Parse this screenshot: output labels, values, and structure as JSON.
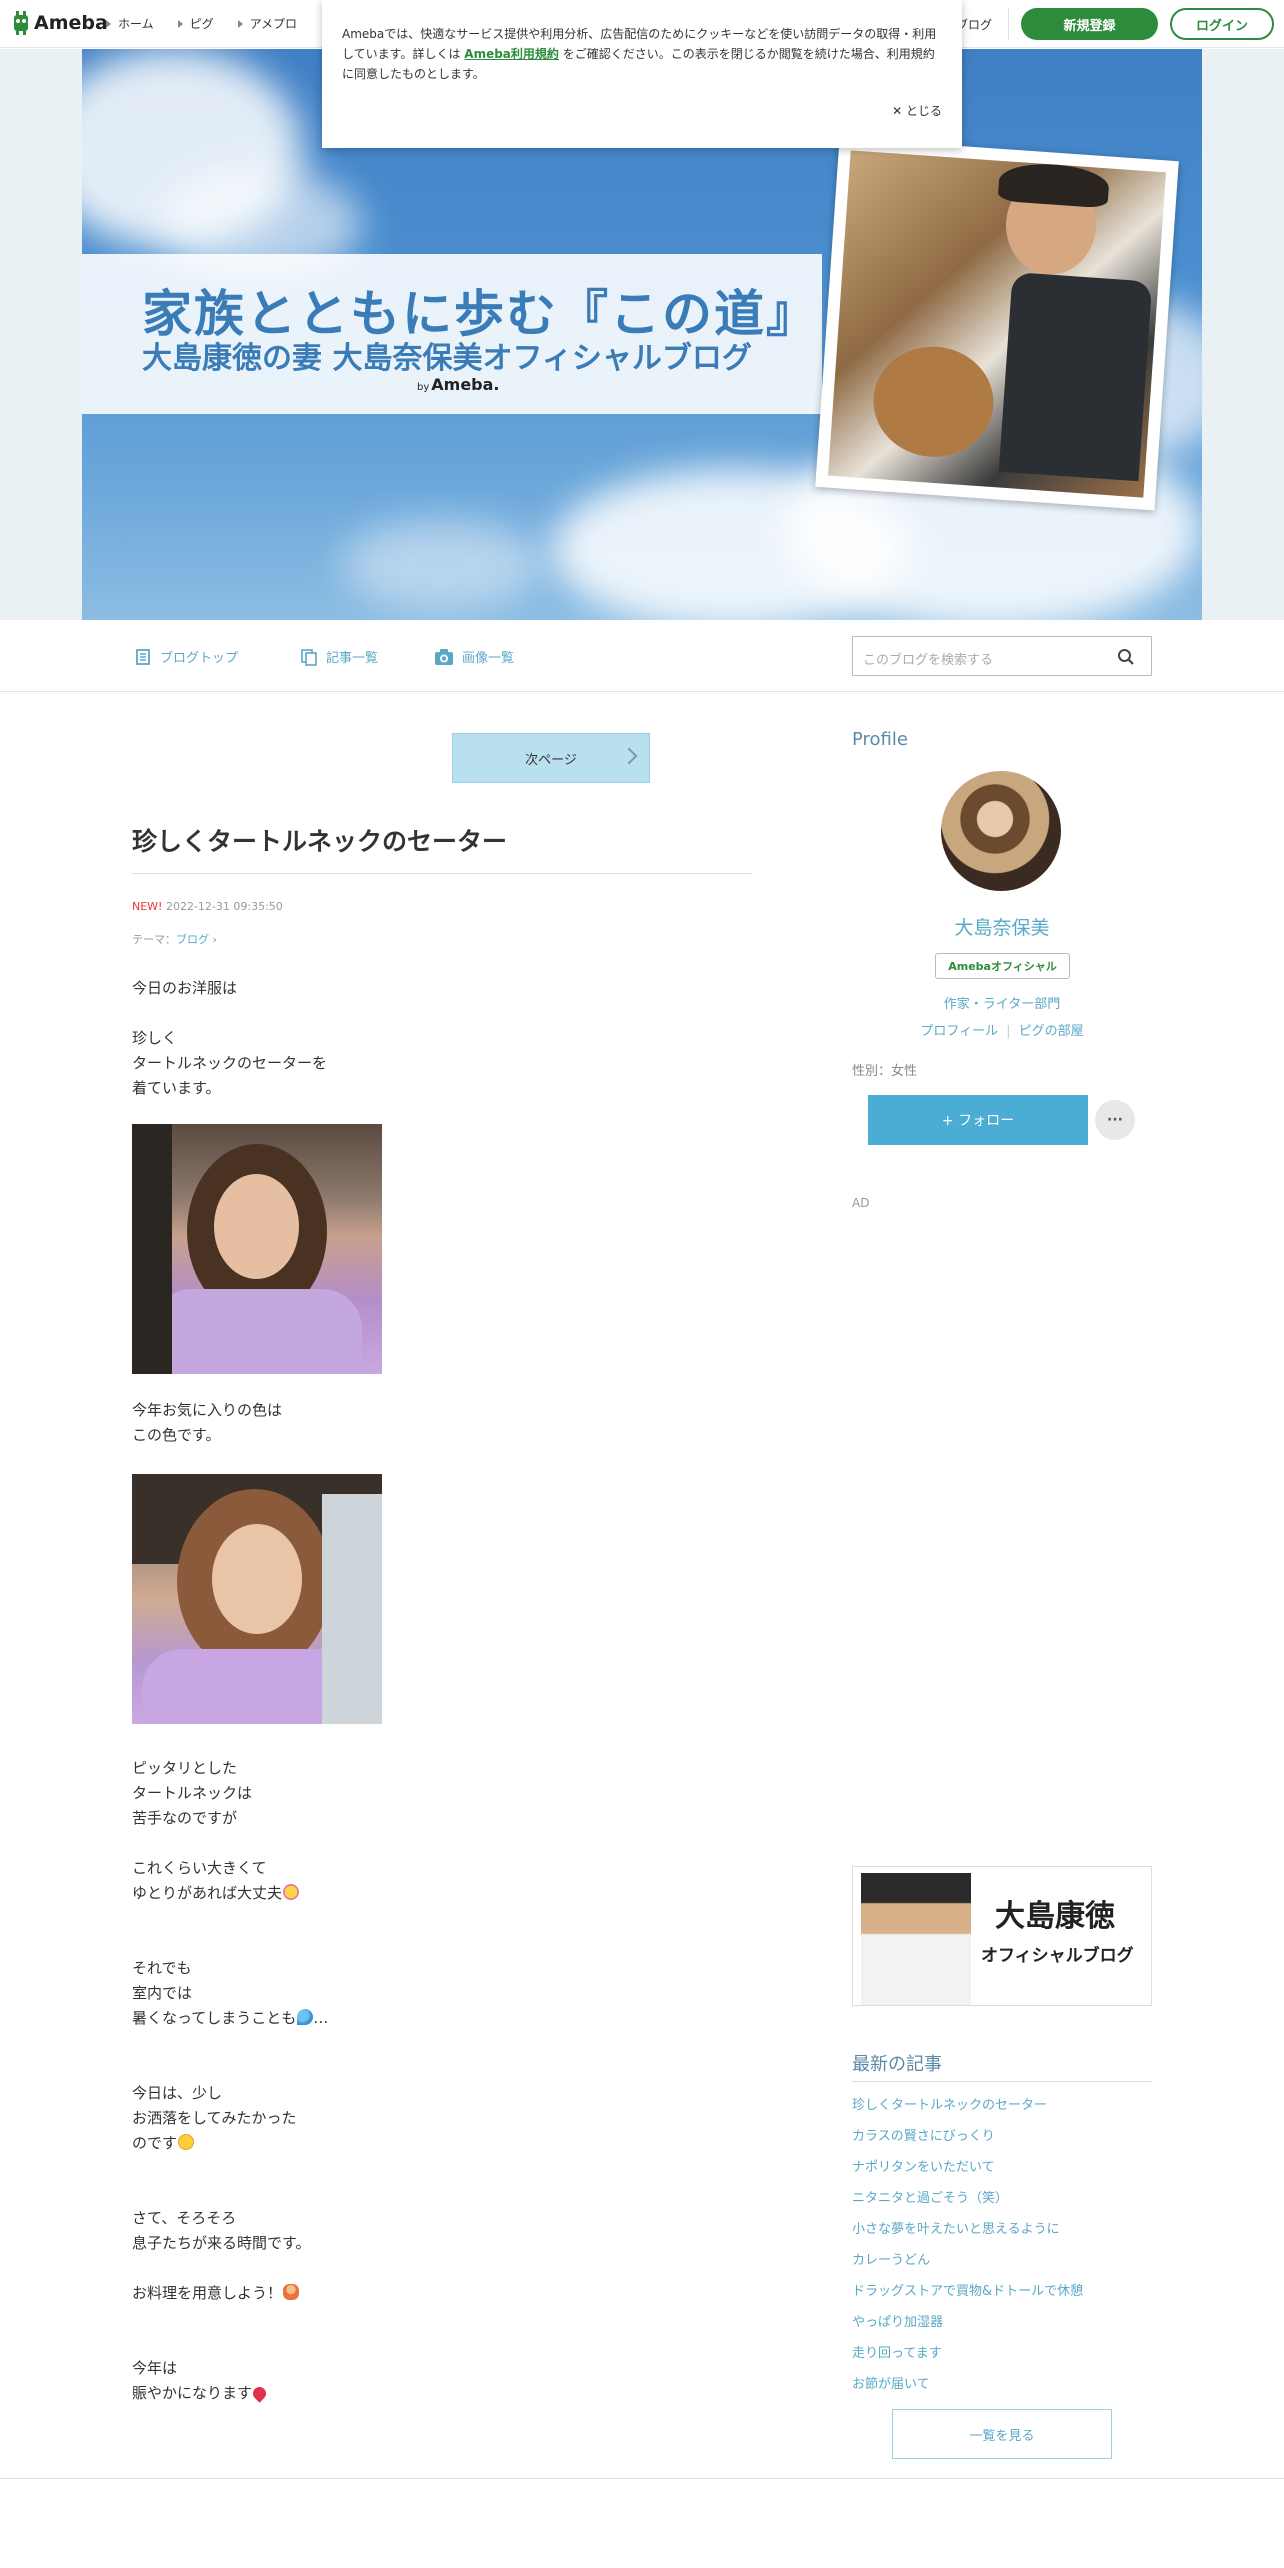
{
  "topbar": {
    "logo": "Ameba",
    "nav": [
      "ホーム",
      "ピグ",
      "アメプロ"
    ],
    "popular_blog": "人気ブログ",
    "register": "新規登録",
    "login": "ログイン"
  },
  "header": {
    "title": "家族とともに歩む『この道』",
    "subtitle": "大島康徳の妻 大島奈保美オフィシャルブログ",
    "by": "by",
    "brand": "Ameba."
  },
  "cookie": {
    "text1": "Amebaでは、快適なサービス提供や利用分析、広告配信のためにクッキーなどを使い訪問データの取得・利用しています。詳しくは",
    "link": "Ameba利用規約",
    "text2": "をご確認ください。この表示を閉じるか閲覧を続けた場合、利用規約に同意したものとします。",
    "close": "とじる"
  },
  "blognav": {
    "items": [
      "ブログトップ",
      "記事一覧",
      "画像一覧"
    ],
    "search_placeholder": "このブログを検索する"
  },
  "article": {
    "next_page": "次ページ",
    "title": "珍しくタートルネックのセーター",
    "new_label": "NEW!",
    "date": "2022-12-31 09:35:50",
    "theme_label": "テーマ：",
    "theme": "ブログ",
    "p1": "今日のお洋服は",
    "p2a": "珍しく",
    "p2b": "タートルネックのセーターを",
    "p2c": "着ています。",
    "p3a": "今年お気に入りの色は",
    "p3b": "この色です。",
    "p4a": "ピッタリとした",
    "p4b": "タートルネックは",
    "p4c": "苦手なのですが",
    "p5a": "これくらい大きくて",
    "p5b": "ゆとりがあれば大丈夫",
    "p6a": "それでも",
    "p6b": "室内では",
    "p6c": "暑くなってしまうことも",
    "p6d": "…",
    "p7a": "今日は、少し",
    "p7b": "お洒落をしてみたかった",
    "p7c": "のです",
    "p8a": "さて、そろそろ",
    "p8b": "息子たちが来る時間です。",
    "p9": "お料理を用意しよう！",
    "p10a": "今年は",
    "p10b": "賑やかになります"
  },
  "sidebar": {
    "profile_title": "Profile",
    "name": "大島奈保美",
    "official": "Amebaオフィシャル",
    "category": "作家・ライター部門",
    "link_profile": "プロフィール",
    "link_pig": "ピグの部屋",
    "gender": "性別：女性",
    "follow": "+ フォロー",
    "more": "···",
    "ad": "AD",
    "banner_name": "大島康徳",
    "banner_sub": "オフィシャルブログ",
    "latest_title": "最新の記事",
    "latest": [
      "珍しくタートルネックのセーター",
      "カラスの賢さにびっくり",
      "ナポリタンをいただいて",
      "ニタニタと過ごそう（笑）",
      "小さな夢を叶えたいと思えるように",
      "カレーうどん",
      "ドラッグストアで買物&ドトールで休憩",
      "やっぱり加湿器",
      "走り回ってます",
      "お節が届いて"
    ],
    "see_all": "一覧を見る"
  }
}
